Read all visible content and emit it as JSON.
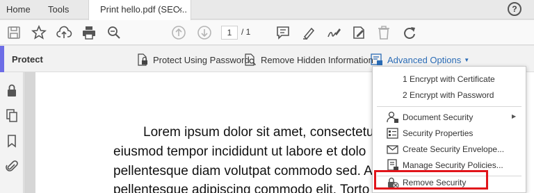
{
  "tabs": {
    "home": "Home",
    "tools": "Tools",
    "document_title": "Print hello.pdf (SEC...",
    "close_symbol": "×",
    "help_symbol": "?"
  },
  "toolbar": {
    "current_page": "1",
    "page_total": "/ 1"
  },
  "protect_bar": {
    "title": "Protect",
    "items": [
      {
        "label": "Protect Using Password",
        "icon": "lock-document-icon"
      },
      {
        "label": "Remove Hidden Information",
        "icon": "search-document-icon"
      },
      {
        "label": "Advanced Options",
        "icon": "advanced-options-icon"
      }
    ],
    "accent_color": "#6d6de6",
    "link_color": "#2a6bb5"
  },
  "menu": {
    "items": [
      {
        "label": "1 Encrypt with Certificate",
        "mnemonic": "1"
      },
      {
        "label": "2 Encrypt with Password",
        "mnemonic": "2"
      },
      {
        "label": "Document Security",
        "icon": "user-lock-icon",
        "has_submenu": true
      },
      {
        "label": "Security Properties",
        "icon": "properties-icon"
      },
      {
        "label": "Create Security Envelope...",
        "icon": "envelope-icon"
      },
      {
        "label": "Manage Security Policies...",
        "icon": "policies-icon"
      },
      {
        "label": "Remove Security",
        "icon": "remove-security-icon"
      }
    ],
    "highlight_color": "#e1141a"
  },
  "document": {
    "lines": [
      "Lorem ipsum dolor sit amet, consectetu",
      "eiusmod tempor incididunt ut labore et dolo",
      "pellentesque diam volutpat commodo sed. A",
      "pellentesque adipiscing commodo elit. Torto"
    ]
  }
}
